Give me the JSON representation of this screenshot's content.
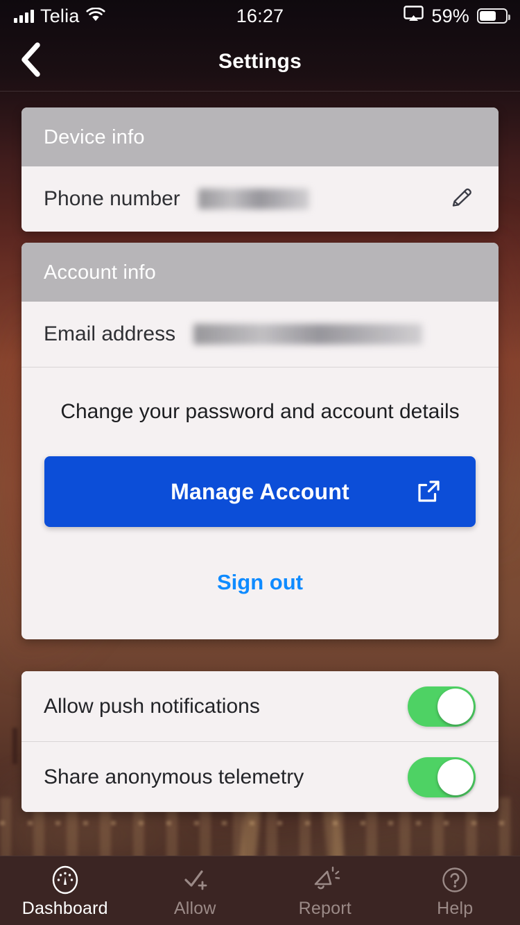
{
  "status_bar": {
    "carrier": "Telia",
    "time": "16:27",
    "battery_percent": "59%",
    "signal_icon": "signal-bars-icon",
    "wifi_icon": "wifi-icon",
    "airplay_icon": "airplay-screen-mirroring-icon",
    "battery_icon": "battery-icon",
    "battery_level": 58
  },
  "nav": {
    "title": "Settings",
    "back_icon": "chevron-left-icon"
  },
  "device_info": {
    "header": "Device info",
    "rows": [
      {
        "label": "Phone number",
        "value": "",
        "redacted": true,
        "edit_icon": "pencil-edit-icon"
      }
    ]
  },
  "account_info": {
    "header": "Account info",
    "rows": [
      {
        "label": "Email address",
        "value": "",
        "redacted": true
      }
    ],
    "promo_text": "Change your password and account details",
    "cta_label": "Manage Account",
    "cta_icon": "external-link-icon",
    "signout_label": "Sign out"
  },
  "preferences": {
    "toggles": [
      {
        "label": "Allow push notifications",
        "on": true
      },
      {
        "label": "Share anonymous telemetry",
        "on": true
      }
    ]
  },
  "tabbar": {
    "items": [
      {
        "label": "Dashboard",
        "icon": "speedometer-gauge-icon",
        "active": true
      },
      {
        "label": "Allow",
        "icon": "check-plus-icon",
        "active": false
      },
      {
        "label": "Report",
        "icon": "megaphone-icon",
        "active": false
      },
      {
        "label": "Help",
        "icon": "question-circle-icon",
        "active": false
      }
    ]
  },
  "colors": {
    "cta_blue": "#0c4ed8",
    "link_blue": "#0f8bff",
    "toggle_green": "#4ed264",
    "card_bg": "#f5f1f2",
    "card_header_gray": "#b7b5b8",
    "tabbar_bg": "#3b2523"
  }
}
